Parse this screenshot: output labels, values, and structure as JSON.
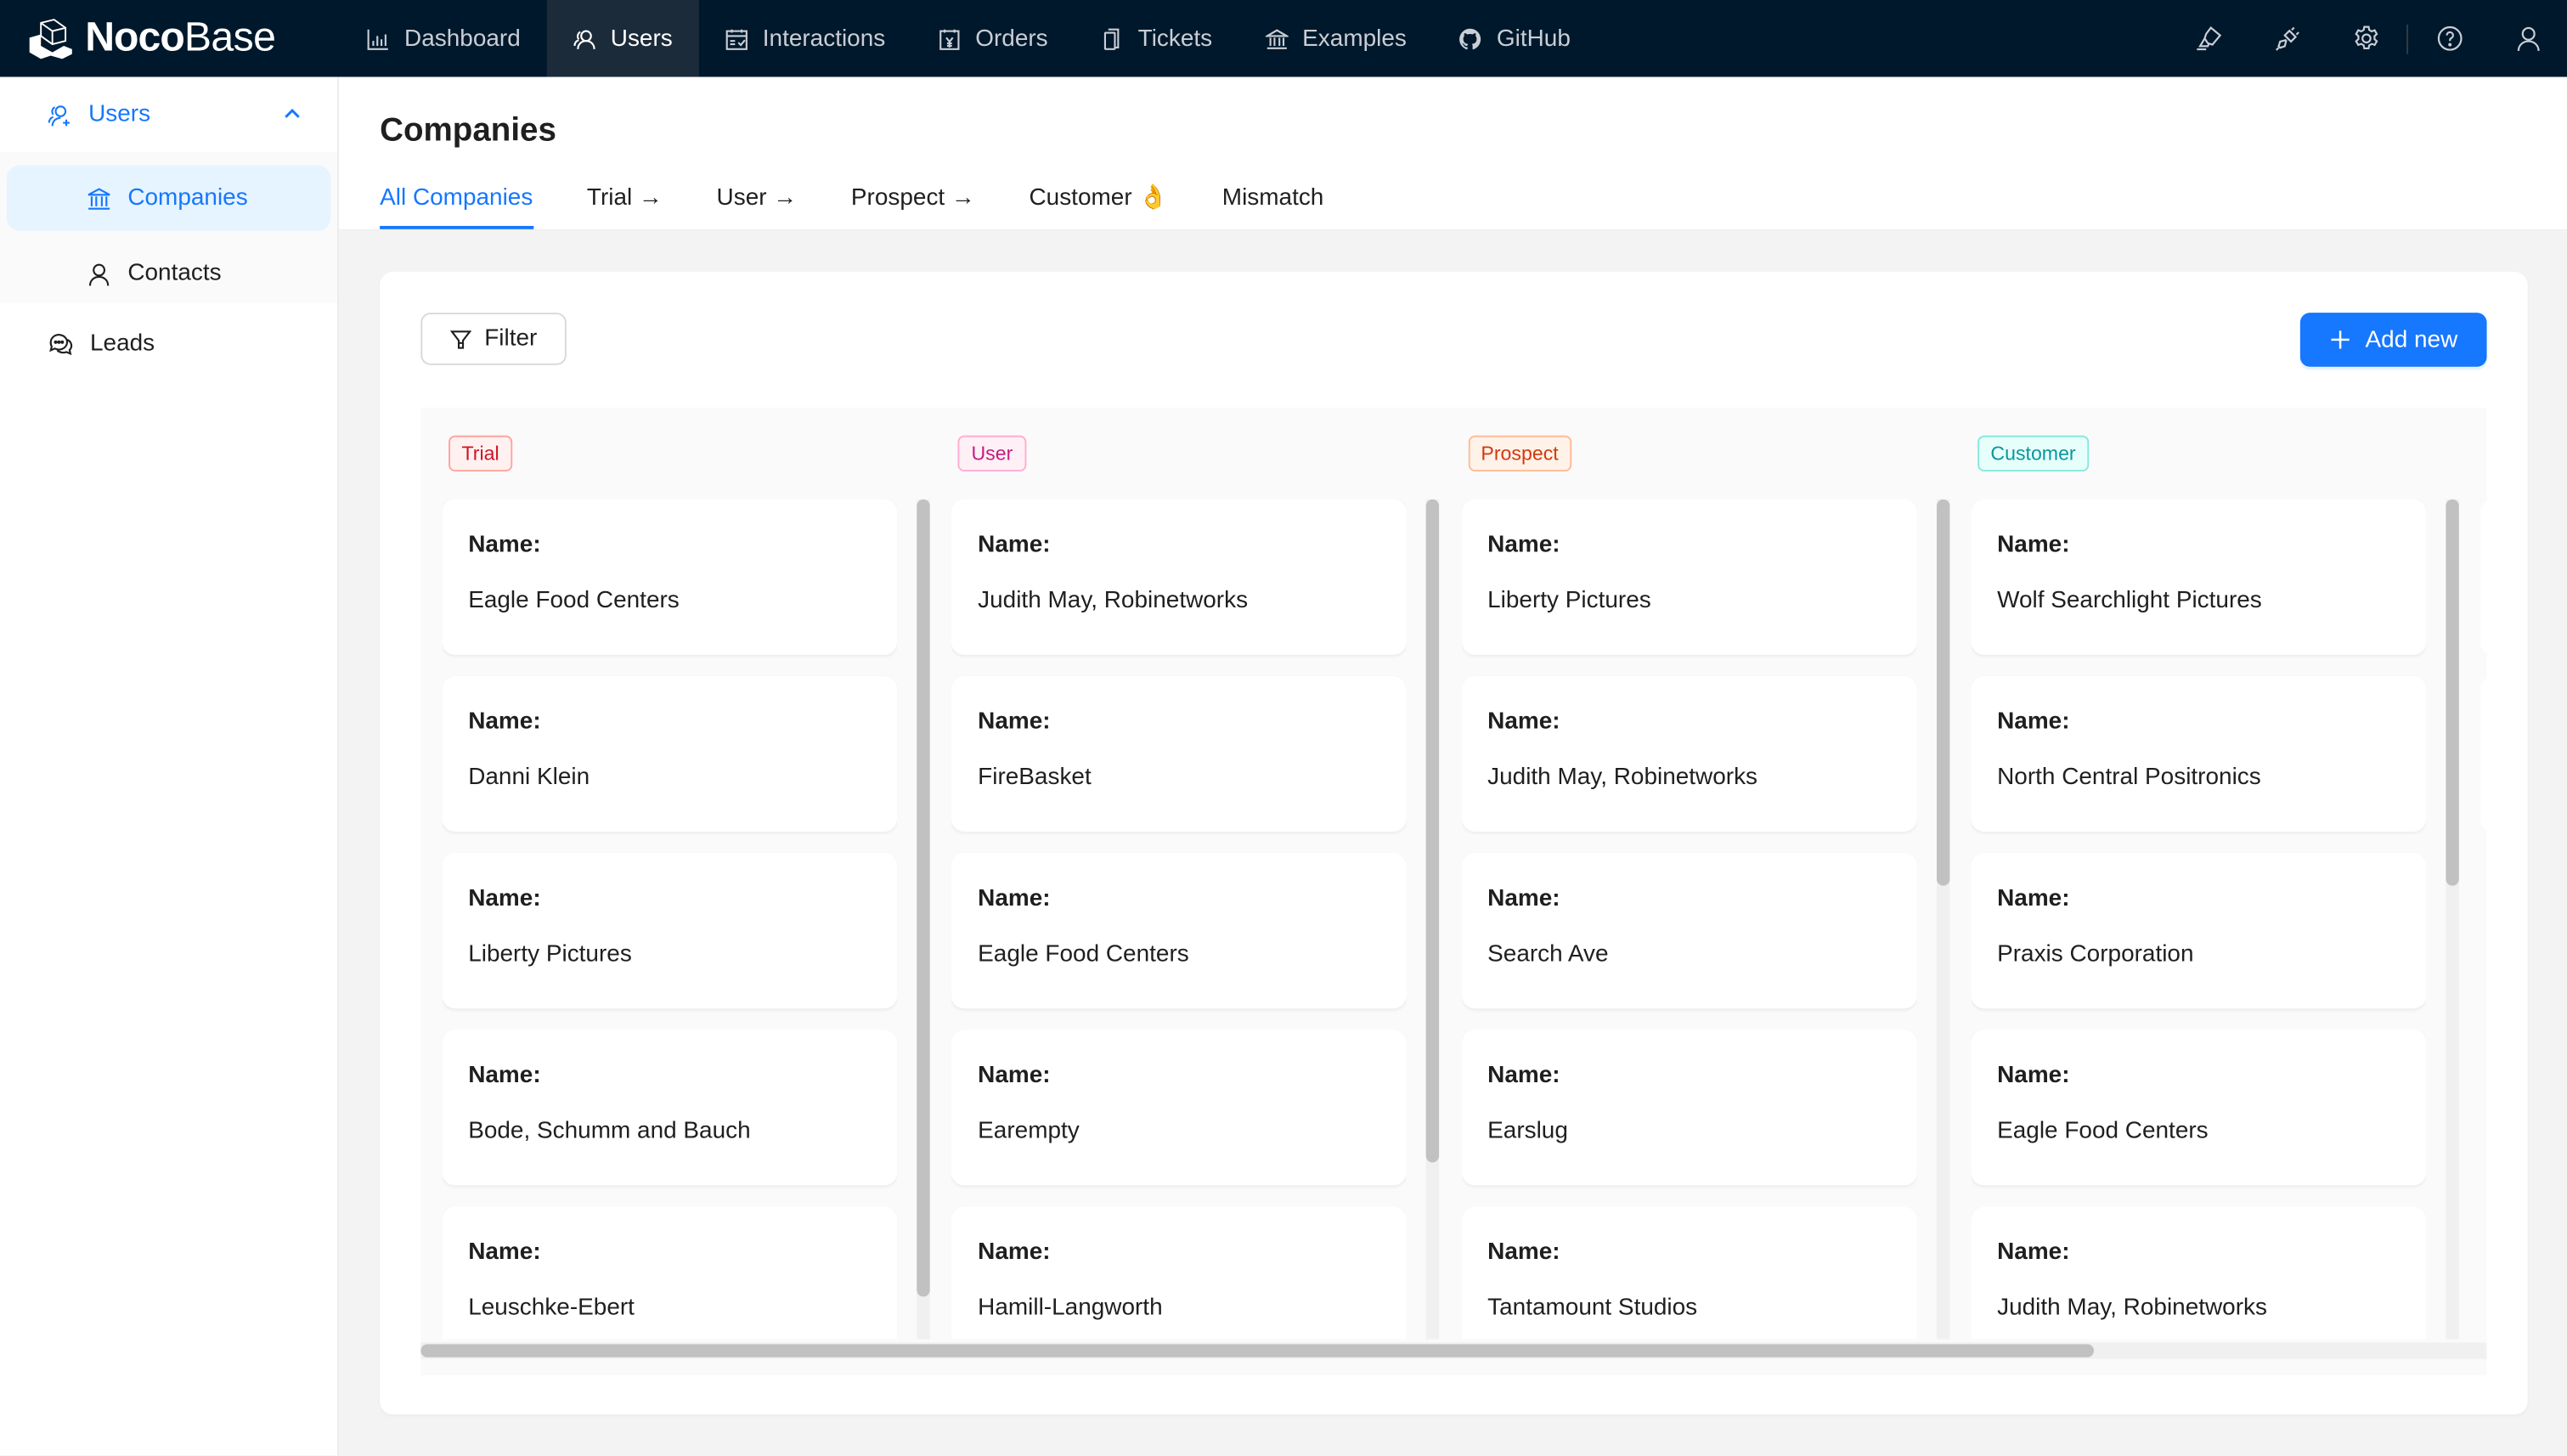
{
  "app": {
    "logo_bold": "Noco",
    "logo_light": "Base"
  },
  "topnav": {
    "items": [
      {
        "label": "Dashboard",
        "icon": "bar-chart-icon",
        "active": false
      },
      {
        "label": "Users",
        "icon": "users-icon",
        "active": true
      },
      {
        "label": "Interactions",
        "icon": "calendar-check-icon",
        "active": false
      },
      {
        "label": "Orders",
        "icon": "calendar-yen-icon",
        "active": false
      },
      {
        "label": "Tickets",
        "icon": "tickets-icon",
        "active": false
      },
      {
        "label": "Examples",
        "icon": "bank-icon",
        "active": false
      },
      {
        "label": "GitHub",
        "icon": "github-icon",
        "active": false
      }
    ],
    "right_icons": [
      "highlight-icon",
      "plugin-icon",
      "settings-icon",
      "help-icon",
      "user-icon"
    ]
  },
  "sidebar": {
    "group": {
      "label": "Users",
      "expanded": true
    },
    "sub_items": [
      {
        "label": "Companies",
        "icon": "bank-icon",
        "active": true
      },
      {
        "label": "Contacts",
        "icon": "user-icon",
        "active": false
      }
    ],
    "items": [
      {
        "label": "Leads",
        "icon": "comments-icon"
      }
    ]
  },
  "page": {
    "title": "Companies",
    "tabs": [
      {
        "label": "All Companies",
        "active": true
      },
      {
        "label": "Trial →",
        "active": false
      },
      {
        "label": "User →",
        "active": false
      },
      {
        "label": "Prospect →",
        "active": false
      },
      {
        "label": "Customer 👌",
        "active": false
      },
      {
        "label": "Mismatch",
        "active": false
      }
    ]
  },
  "toolbar": {
    "filter_label": "Filter",
    "add_label": "Add new"
  },
  "kanban": {
    "field_label": "Name:",
    "columns": [
      {
        "tag": "Trial",
        "tag_color": "#cf1322",
        "tag_bg": "#fff1f0",
        "tag_border": "#ffa39e",
        "scroll_thumb_fraction": 0.95,
        "cards": [
          "Eagle Food Centers",
          "Danni Klein",
          "Liberty Pictures",
          "Bode, Schumm and Bauch",
          "Leuschke-Ebert"
        ]
      },
      {
        "tag": "User",
        "tag_color": "#c41d7f",
        "tag_bg": "#fff0f6",
        "tag_border": "#ffadd2",
        "scroll_thumb_fraction": 0.79,
        "cards": [
          "Judith May, Robinetworks",
          "FireBasket",
          "Eagle Food Centers",
          "Earempty",
          "Hamill-Langworth"
        ]
      },
      {
        "tag": "Prospect",
        "tag_color": "#d4380d",
        "tag_bg": "#fff2e8",
        "tag_border": "#ffbb96",
        "scroll_thumb_fraction": 0.46,
        "cards": [
          "Liberty Pictures",
          "Judith May, Robinetworks",
          "Search Ave",
          "Earslug",
          "Tantamount Studios"
        ]
      },
      {
        "tag": "Customer",
        "tag_color": "#08979c",
        "tag_bg": "#e6fffb",
        "tag_border": "#87e8de",
        "scroll_thumb_fraction": 0.46,
        "cards": [
          "Wolf Searchlight Pictures",
          "North Central Positronics",
          "Praxis Corporation",
          "Eagle Food Centers",
          "Judith May, Robinetworks"
        ]
      }
    ],
    "horizontal_scroll_thumb_fraction": 0.81
  },
  "colors": {
    "primary": "#1677ff",
    "topbar_bg": "#00182b"
  }
}
